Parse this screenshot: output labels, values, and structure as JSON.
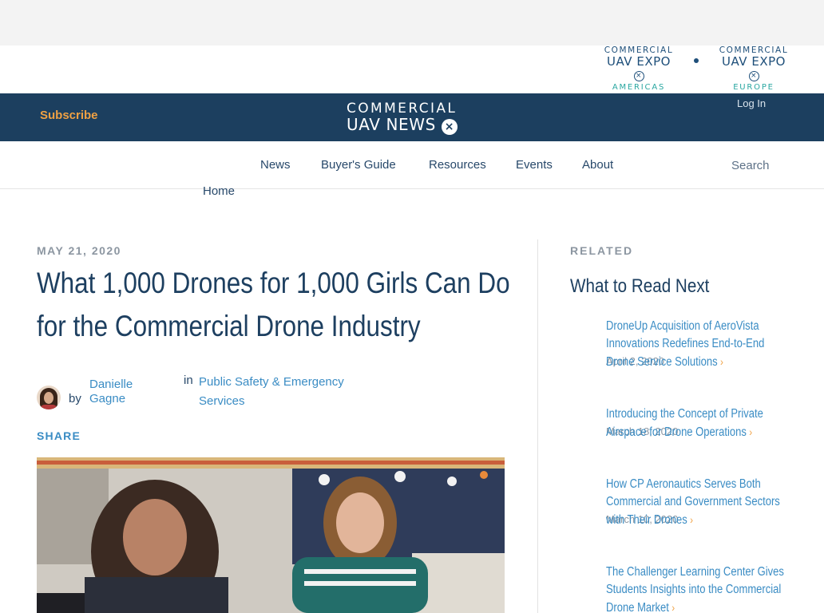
{
  "expo": {
    "americas": {
      "line1": "COMMERCIAL",
      "line2": "UAV EXPO",
      "line3": "AMERICAS"
    },
    "europe": {
      "line1": "COMMERCIAL",
      "line2": "UAV EXPO",
      "line3": "EUROPE"
    },
    "x_glyph": "×"
  },
  "brand": {
    "subscribe_label": "Subscribe",
    "login_label": "Log In",
    "logo_line1": "COMMERCIAL",
    "logo_line2": "UAV NEWS",
    "logo_x": "×"
  },
  "nav": {
    "items": [
      "News",
      "Buyer's Guide",
      "Resources",
      "Events",
      "About"
    ],
    "search_placeholder": "Search"
  },
  "breadcrumb": {
    "home": "Home"
  },
  "article": {
    "date": "MAY 21, 2020",
    "title_line1": "What 1,000 Drones for 1,000 Girls Can Do",
    "title_line2": "for the Commercial Drone Industry",
    "by_label": "by",
    "author": "Danielle Gagne",
    "in_label": "in",
    "category": "Public Safety & Emergency Services",
    "share_label": "SHARE"
  },
  "sidebar": {
    "related_label": "RELATED",
    "heading": "What to Read Next",
    "chevron": "›",
    "items": [
      {
        "title": "DroneUp Acquisition of AeroVista Innovations Redefines End-to-End Drone Service Solutions",
        "date": "April 2, 2020"
      },
      {
        "title": "Introducing the Concept of Private Airspace for Drone Operations",
        "date": "March 18, 2020"
      },
      {
        "title": "How CP Aeronautics Serves Both Commercial and Government Sectors with Their Drones",
        "date": "March 10, 2020"
      },
      {
        "title": "The Challenger Learning Center Gives Students Insights into the Commercial Drone Market",
        "date": ""
      }
    ]
  },
  "colors": {
    "brand_navy": "#1c3f5f",
    "accent_orange": "#f0a143",
    "link_blue": "#3a8cc4",
    "expo_teal": "#2aa7a1"
  }
}
